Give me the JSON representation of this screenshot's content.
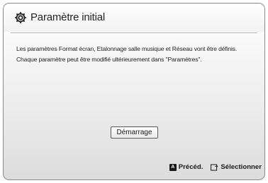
{
  "dialog": {
    "title": "Paramètre initial",
    "title_icon": "gear-icon",
    "description": [
      "Les paramètres Format écran, Etalonnage salle musique et Réseau vont être définis.",
      "Chaque paramètre peut être modifié ultérieurement dans \"Paramètres\"."
    ],
    "start_button": "Démarrage"
  },
  "footer": {
    "previous": {
      "key": "A",
      "label": "Précéd.",
      "icon": "a-key-icon"
    },
    "select": {
      "label": "Sélectionner",
      "icon": "enter-icon"
    }
  }
}
